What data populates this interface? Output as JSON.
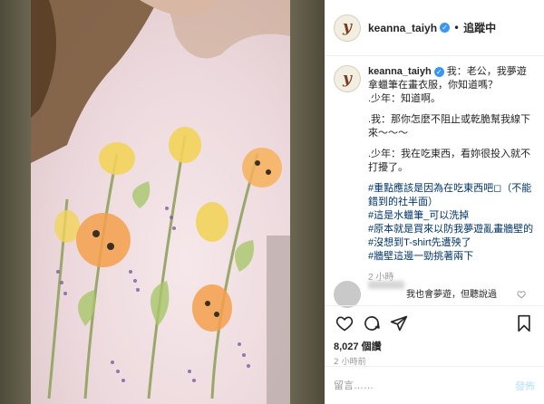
{
  "post": {
    "username": "keanna_taiyh",
    "verified_mark": "✓",
    "separator": "•",
    "follow_label": "追蹤中",
    "avatar_letter": "y"
  },
  "caption": {
    "username": "keanna_taiyh",
    "paragraphs": [
      "我：老公，我夢遊拿蠟筆在畫衣服，你知道嗎？",
      ".少年：知道啊。",
      ".我：那你怎麼不阻止或乾脆幫我線下來～～～",
      ".少年：我在吃東西，看妳很投入就不打擾了。"
    ],
    "hashtags": [
      "#重點應該是因為在吃東西吧◻（不能錯到的社半面）",
      "#這是水蠟筆_可以洗掉",
      "#原本就是買來以防我夢遊亂畫牆壁的",
      "#沒想到T-shirt先遭殃了",
      "#牆壁這邊一勁挑著兩下"
    ],
    "time": "2 小時"
  },
  "comment": {
    "text": "我也會夢遊，但聽說過"
  },
  "actions": {
    "like_icon": "heart-icon",
    "comment_icon": "comment-icon",
    "share_icon": "share-icon",
    "save_icon": "bookmark-icon",
    "likes": "8,027 個讚",
    "time": "2 小時前"
  },
  "comment_box": {
    "placeholder": "留言……",
    "post_label": "發佈"
  },
  "colors": {
    "accent_blue": "#3897f0",
    "post_button_disabled": "#b2dffc",
    "hashtag": "#003569"
  }
}
